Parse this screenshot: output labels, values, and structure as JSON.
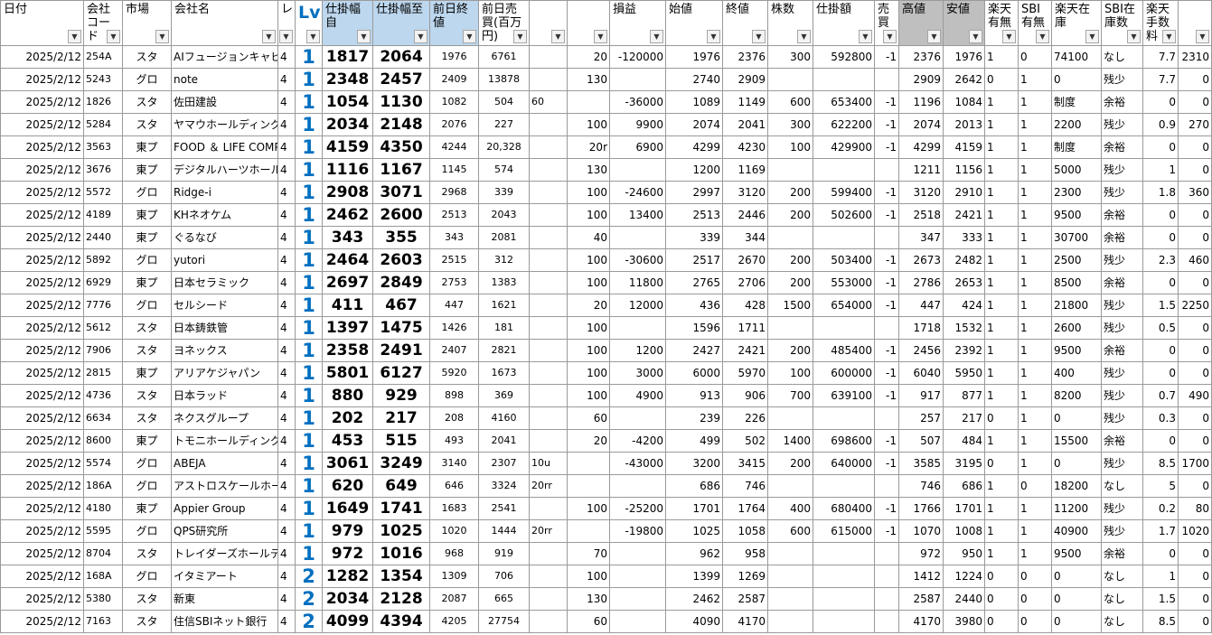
{
  "columns": [
    {
      "key": "date",
      "label": "日付",
      "align": "r"
    },
    {
      "key": "code",
      "label": "会社コード",
      "align": "l"
    },
    {
      "key": "market",
      "label": "市場",
      "align": "c"
    },
    {
      "key": "name",
      "label": "会社名",
      "align": "l"
    },
    {
      "key": "re",
      "label": "レ",
      "align": "l"
    },
    {
      "key": "lv",
      "label": "Lv",
      "align": "lv"
    },
    {
      "key": "from",
      "label": "仕掛幅自",
      "align": "big"
    },
    {
      "key": "to",
      "label": "仕掛幅至",
      "align": "big"
    },
    {
      "key": "prev_close",
      "label": "前日終値",
      "align": "c"
    },
    {
      "key": "prev_volume",
      "label": "前日売買(百万円)",
      "align": "c"
    },
    {
      "key": "memo",
      "label": "",
      "align": "l"
    },
    {
      "key": "col_l",
      "label": "",
      "align": "r"
    },
    {
      "key": "pl",
      "label": "損益",
      "align": "r"
    },
    {
      "key": "open",
      "label": "始値",
      "align": "r"
    },
    {
      "key": "close",
      "label": "終値",
      "align": "r"
    },
    {
      "key": "shares",
      "label": "株数",
      "align": "r"
    },
    {
      "key": "amount",
      "label": "仕掛額",
      "align": "r"
    },
    {
      "key": "side",
      "label": "売買",
      "align": "r"
    },
    {
      "key": "high",
      "label": "高値",
      "align": "r"
    },
    {
      "key": "low",
      "label": "安値",
      "align": "r"
    },
    {
      "key": "rk_avail",
      "label": "楽天有無",
      "align": "l"
    },
    {
      "key": "sbi_avail",
      "label": "SBI有無",
      "align": "l"
    },
    {
      "key": "rk_stock",
      "label": "楽天在庫",
      "align": "l"
    },
    {
      "key": "sbi_stock",
      "label": "SBI在庫数",
      "align": "l"
    },
    {
      "key": "rk_fee",
      "label": "楽天手数料",
      "align": "r"
    },
    {
      "key": "last",
      "label": "",
      "align": "r"
    }
  ],
  "rows": [
    [
      "2025/2/12",
      "254A",
      "スタ",
      "AIフュージョンキャピタル",
      "4",
      "1",
      "1817",
      "2064",
      "1976",
      "6761",
      "",
      "20",
      "-120000",
      "1976",
      "2376",
      "300",
      "592800",
      "-1",
      "2376",
      "1976",
      "1",
      "0",
      "74100",
      "なし",
      "7.7",
      "2310"
    ],
    [
      "2025/2/12",
      "5243",
      "グロ",
      "note",
      "4",
      "1",
      "2348",
      "2457",
      "2409",
      "13878",
      "",
      "130",
      "",
      "2740",
      "2909",
      "",
      "",
      "",
      "2909",
      "2642",
      "0",
      "1",
      "0",
      "残少",
      "7.7",
      "0"
    ],
    [
      "2025/2/12",
      "1826",
      "スタ",
      "佐田建設",
      "4",
      "1",
      "1054",
      "1130",
      "1082",
      "504",
      "60",
      "",
      "-36000",
      "1089",
      "1149",
      "600",
      "653400",
      "-1",
      "1196",
      "1084",
      "1",
      "1",
      "制度",
      "余裕",
      "0",
      "0"
    ],
    [
      "2025/2/12",
      "5284",
      "スタ",
      "ヤマウホールディングス",
      "4",
      "1",
      "2034",
      "2148",
      "2076",
      "227",
      "",
      "100",
      "9900",
      "2074",
      "2041",
      "300",
      "622200",
      "-1",
      "2074",
      "2013",
      "1",
      "1",
      "2200",
      "残少",
      "0.9",
      "270"
    ],
    [
      "2025/2/12",
      "3563",
      "東プ",
      "FOOD ＆ LIFE COMPANIES",
      "4",
      "1",
      "4159",
      "4350",
      "4244",
      "20,328",
      "",
      "20r",
      "6900",
      "4299",
      "4230",
      "100",
      "429900",
      "-1",
      "4299",
      "4159",
      "1",
      "1",
      "制度",
      "余裕",
      "0",
      "0"
    ],
    [
      "2025/2/12",
      "3676",
      "東プ",
      "デジタルハーツホールディングス",
      "4",
      "1",
      "1116",
      "1167",
      "1145",
      "574",
      "",
      "130",
      "",
      "1200",
      "1169",
      "",
      "",
      "",
      "1211",
      "1156",
      "1",
      "1",
      "5000",
      "残少",
      "1",
      "0"
    ],
    [
      "2025/2/12",
      "5572",
      "グロ",
      "Ridge-i",
      "4",
      "1",
      "2908",
      "3071",
      "2968",
      "339",
      "",
      "100",
      "-24600",
      "2997",
      "3120",
      "200",
      "599400",
      "-1",
      "3120",
      "2910",
      "1",
      "1",
      "2300",
      "残少",
      "1.8",
      "360"
    ],
    [
      "2025/2/12",
      "4189",
      "東プ",
      "KHネオケム",
      "4",
      "1",
      "2462",
      "2600",
      "2513",
      "2043",
      "",
      "100",
      "13400",
      "2513",
      "2446",
      "200",
      "502600",
      "-1",
      "2518",
      "2421",
      "1",
      "1",
      "9500",
      "余裕",
      "0",
      "0"
    ],
    [
      "2025/2/12",
      "2440",
      "東プ",
      "ぐるなび",
      "4",
      "1",
      "343",
      "355",
      "343",
      "2081",
      "",
      "40",
      "",
      "339",
      "344",
      "",
      "",
      "",
      "347",
      "333",
      "1",
      "1",
      "30700",
      "余裕",
      "0",
      "0"
    ],
    [
      "2025/2/12",
      "5892",
      "グロ",
      "yutori",
      "4",
      "1",
      "2464",
      "2603",
      "2515",
      "312",
      "",
      "100",
      "-30600",
      "2517",
      "2670",
      "200",
      "503400",
      "-1",
      "2673",
      "2482",
      "1",
      "1",
      "2500",
      "残少",
      "2.3",
      "460"
    ],
    [
      "2025/2/12",
      "6929",
      "東プ",
      "日本セラミック",
      "4",
      "1",
      "2697",
      "2849",
      "2753",
      "1383",
      "",
      "100",
      "11800",
      "2765",
      "2706",
      "200",
      "553000",
      "-1",
      "2786",
      "2653",
      "1",
      "1",
      "8500",
      "余裕",
      "0",
      "0"
    ],
    [
      "2025/2/12",
      "7776",
      "グロ",
      "セルシード",
      "4",
      "1",
      "411",
      "467",
      "447",
      "1621",
      "",
      "20",
      "12000",
      "436",
      "428",
      "1500",
      "654000",
      "-1",
      "447",
      "424",
      "1",
      "1",
      "21800",
      "残少",
      "1.5",
      "2250"
    ],
    [
      "2025/2/12",
      "5612",
      "スタ",
      "日本鋳鉄管",
      "4",
      "1",
      "1397",
      "1475",
      "1426",
      "181",
      "",
      "100",
      "",
      "1596",
      "1711",
      "",
      "",
      "",
      "1718",
      "1532",
      "1",
      "1",
      "2600",
      "残少",
      "0.5",
      "0"
    ],
    [
      "2025/2/12",
      "7906",
      "スタ",
      "ヨネックス",
      "4",
      "1",
      "2358",
      "2491",
      "2407",
      "2821",
      "",
      "100",
      "1200",
      "2427",
      "2421",
      "200",
      "485400",
      "-1",
      "2456",
      "2392",
      "1",
      "1",
      "9500",
      "余裕",
      "0",
      "0"
    ],
    [
      "2025/2/12",
      "2815",
      "東プ",
      "アリアケジャパン",
      "4",
      "1",
      "5801",
      "6127",
      "5920",
      "1673",
      "",
      "100",
      "3000",
      "6000",
      "5970",
      "100",
      "600000",
      "-1",
      "6040",
      "5950",
      "1",
      "1",
      "400",
      "残少",
      "0",
      "0"
    ],
    [
      "2025/2/12",
      "4736",
      "スタ",
      "日本ラッド",
      "4",
      "1",
      "880",
      "929",
      "898",
      "369",
      "",
      "100",
      "4900",
      "913",
      "906",
      "700",
      "639100",
      "-1",
      "917",
      "877",
      "1",
      "1",
      "8200",
      "残少",
      "0.7",
      "490"
    ],
    [
      "2025/2/12",
      "6634",
      "スタ",
      "ネクスグループ",
      "4",
      "1",
      "202",
      "217",
      "208",
      "4160",
      "",
      "60",
      "",
      "239",
      "226",
      "",
      "",
      "",
      "257",
      "217",
      "0",
      "1",
      "0",
      "残少",
      "0.3",
      "0"
    ],
    [
      "2025/2/12",
      "8600",
      "東プ",
      "トモニホールディングス",
      "4",
      "1",
      "453",
      "515",
      "493",
      "2041",
      "",
      "20",
      "-4200",
      "499",
      "502",
      "1400",
      "698600",
      "-1",
      "507",
      "484",
      "1",
      "1",
      "15500",
      "余裕",
      "0",
      "0"
    ],
    [
      "2025/2/12",
      "5574",
      "グロ",
      "ABEJA",
      "4",
      "1",
      "3061",
      "3249",
      "3140",
      "2307",
      "10u",
      "",
      "-43000",
      "3200",
      "3415",
      "200",
      "640000",
      "-1",
      "3585",
      "3195",
      "0",
      "1",
      "0",
      "残少",
      "8.5",
      "1700"
    ],
    [
      "2025/2/12",
      "186A",
      "グロ",
      "アストロスケールホールディングス",
      "4",
      "1",
      "620",
      "649",
      "646",
      "3324",
      "20rr",
      "",
      "",
      "686",
      "746",
      "",
      "",
      "",
      "746",
      "686",
      "1",
      "0",
      "18200",
      "なし",
      "5",
      "0"
    ],
    [
      "2025/2/12",
      "4180",
      "東プ",
      "Appier Group",
      "4",
      "1",
      "1649",
      "1741",
      "1683",
      "2541",
      "",
      "100",
      "-25200",
      "1701",
      "1764",
      "400",
      "680400",
      "-1",
      "1766",
      "1701",
      "1",
      "1",
      "11200",
      "残少",
      "0.2",
      "80"
    ],
    [
      "2025/2/12",
      "5595",
      "グロ",
      "QPS研究所",
      "4",
      "1",
      "979",
      "1025",
      "1020",
      "1444",
      "20rr",
      "",
      "-19800",
      "1025",
      "1058",
      "600",
      "615000",
      "-1",
      "1070",
      "1008",
      "1",
      "1",
      "40900",
      "残少",
      "1.7",
      "1020"
    ],
    [
      "2025/2/12",
      "8704",
      "スタ",
      "トレイダーズホールディングス",
      "4",
      "1",
      "972",
      "1016",
      "968",
      "919",
      "",
      "70",
      "",
      "962",
      "958",
      "",
      "",
      "",
      "972",
      "950",
      "1",
      "1",
      "9500",
      "余裕",
      "0",
      "0"
    ],
    [
      "2025/2/12",
      "168A",
      "グロ",
      "イタミアート",
      "4",
      "2",
      "1282",
      "1354",
      "1309",
      "706",
      "",
      "100",
      "",
      "1399",
      "1269",
      "",
      "",
      "",
      "1412",
      "1224",
      "0",
      "0",
      "0",
      "なし",
      "1",
      "0"
    ],
    [
      "2025/2/12",
      "5380",
      "スタ",
      "新東",
      "4",
      "2",
      "2034",
      "2128",
      "2087",
      "665",
      "",
      "130",
      "",
      "2462",
      "2587",
      "",
      "",
      "",
      "2587",
      "2440",
      "0",
      "0",
      "0",
      "なし",
      "1.5",
      "0"
    ],
    [
      "2025/2/12",
      "7163",
      "スタ",
      "住信SBIネット銀行",
      "4",
      "2",
      "4099",
      "4394",
      "4205",
      "27754",
      "",
      "60",
      "",
      "4090",
      "4170",
      "",
      "",
      "",
      "4170",
      "3980",
      "0",
      "0",
      "0",
      "なし",
      "8.5",
      "0"
    ]
  ]
}
